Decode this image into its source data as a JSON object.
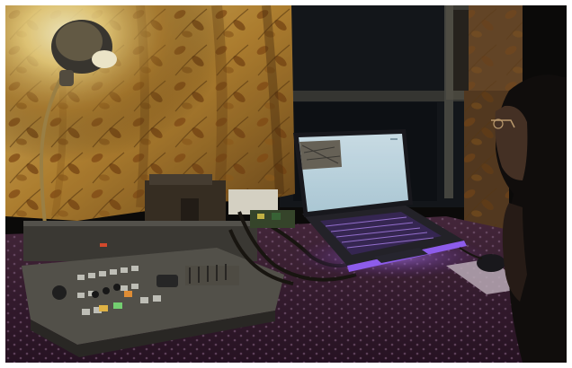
{
  "scene": {
    "subject": "night-desk-video-mixer-laptop",
    "colors": {
      "curtain_warm": "#c79a3c",
      "curtain_light": "#f3df8a",
      "lamp_glow": "#fff6c8",
      "tablecloth": "#3a1e36",
      "tablecloth_dots": "#7e5c7a",
      "mixer_body": "#5d5b55",
      "keyboard_backlight": "#a06cff",
      "laptop_screen": "#cfe6f2",
      "window_night": "#14171c"
    },
    "objects": [
      {
        "name": "desk-lamp",
        "icon": "lamp-icon"
      },
      {
        "name": "floral-curtain",
        "icon": "curtain-icon"
      },
      {
        "name": "video-mixer-console",
        "icon": "mixer-icon"
      },
      {
        "name": "laptop-rgb-keyboard",
        "icon": "laptop-icon"
      },
      {
        "name": "person-with-glasses",
        "icon": "person-icon"
      },
      {
        "name": "computer-mouse",
        "icon": "mouse-icon"
      }
    ]
  }
}
